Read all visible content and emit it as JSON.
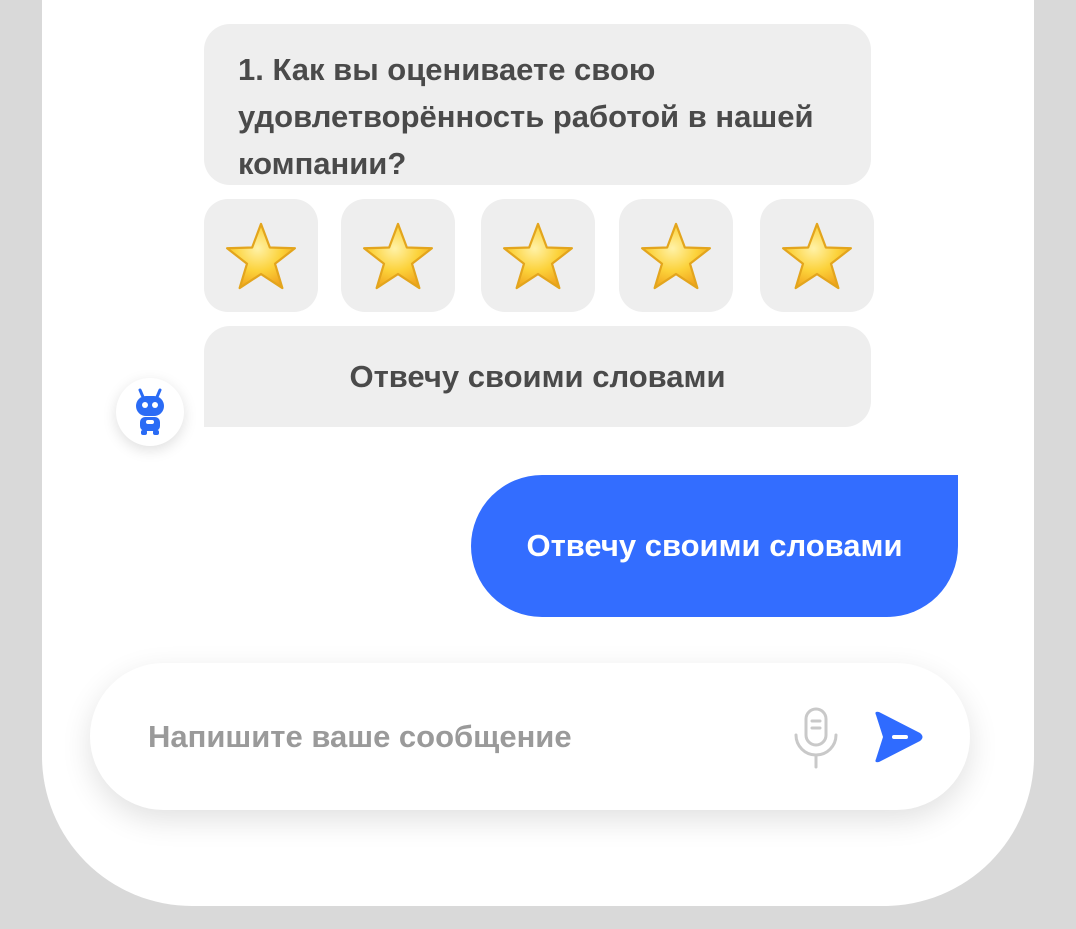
{
  "chat": {
    "bot": {
      "avatar_icon": "robot-icon",
      "question": "1. Как вы оцениваете свою удовлетворённость работой в нашей компании?",
      "rating": {
        "max": 5,
        "star_icon": "star-icon",
        "star_color": "#f7c531"
      },
      "own_words_option": "Отвечу своими словами"
    },
    "user": {
      "message": "Отвечу своими словами"
    }
  },
  "composer": {
    "placeholder": "Напишите ваше сообщение",
    "mic_icon": "microphone-icon",
    "send_icon": "send-icon"
  },
  "colors": {
    "accent": "#336dff",
    "bubble_bg": "#eeeeee",
    "text": "#4a4a4a",
    "background": "#d9d9d9"
  }
}
